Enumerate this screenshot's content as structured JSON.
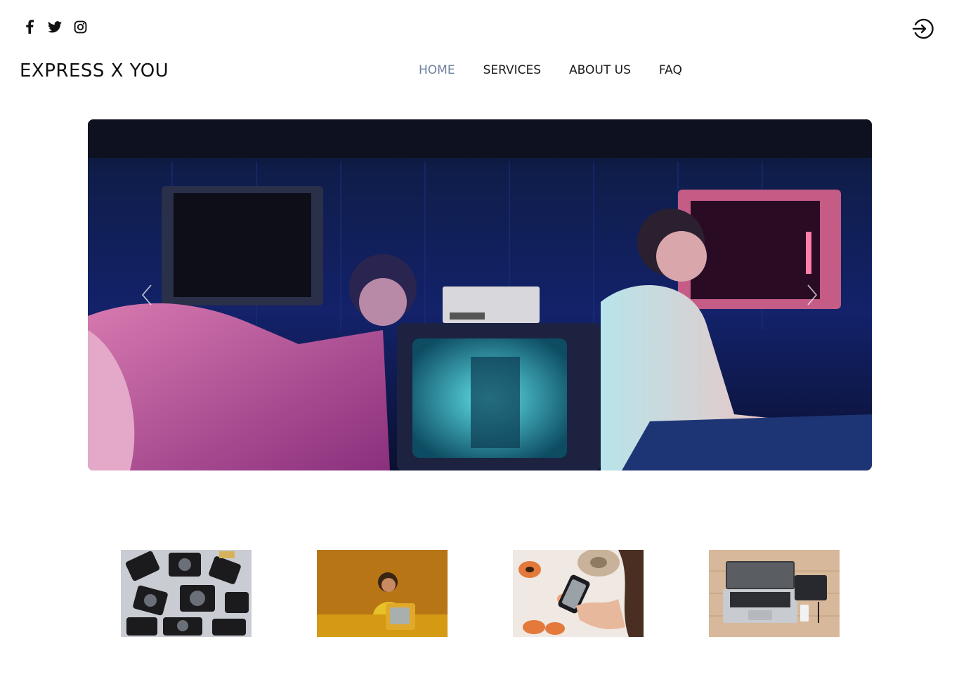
{
  "header": {
    "brand": "EXPRESS X YOU",
    "social_icons": [
      "facebook-icon",
      "twitter-icon",
      "instagram-icon"
    ],
    "login_icon": "login-icon"
  },
  "nav": {
    "items": [
      {
        "label": "HOME",
        "active": true
      },
      {
        "label": "SERVICES",
        "active": false
      },
      {
        "label": "ABOUT US",
        "active": false
      },
      {
        "label": "FAQ",
        "active": false
      }
    ]
  },
  "hero": {
    "icons": {
      "prev": "chevron-left-icon",
      "next": "chevron-right-icon"
    }
  },
  "gallery": {
    "items": [
      "cameras-photo",
      "woman-with-tv-photo",
      "food-phone-photo",
      "laptop-desk-photo"
    ]
  },
  "colors": {
    "nav_active": "#6f819c",
    "text": "#111111",
    "background": "#ffffff"
  }
}
